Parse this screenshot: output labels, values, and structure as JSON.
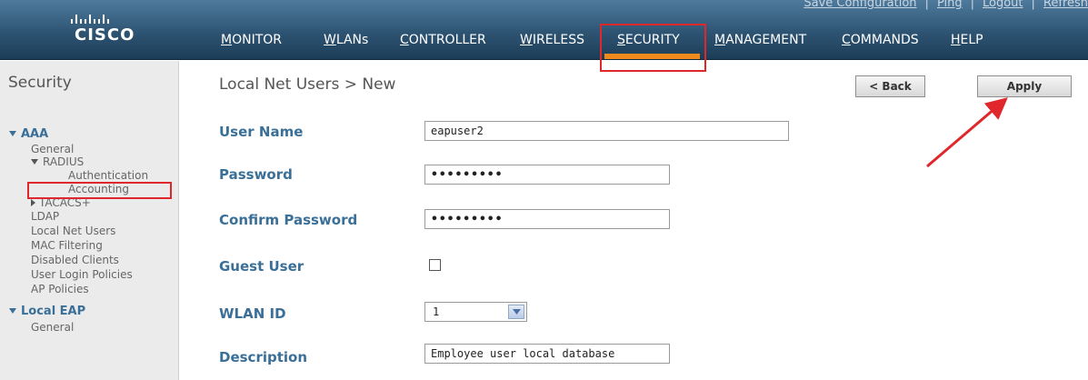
{
  "header": {
    "brand": "CISCO",
    "top_links": [
      "Save Configuration",
      "Ping",
      "Logout",
      "Refresh"
    ],
    "nav": [
      "MONITOR",
      "WLANs",
      "CONTROLLER",
      "WIRELESS",
      "SECURITY",
      "MANAGEMENT",
      "COMMANDS",
      "HELP"
    ],
    "active_nav": "SECURITY",
    "active_color": "#f08a1c"
  },
  "sidebar": {
    "title": "Security",
    "aaa": {
      "label": "AAA",
      "general": "General",
      "radius": "RADIUS",
      "authentication": "Authentication",
      "accounting": "Accounting",
      "tacacs": "TACACS+",
      "ldap": "LDAP",
      "local_net_users": "Local Net Users",
      "mac_filtering": "MAC Filtering",
      "disabled_clients": "Disabled Clients",
      "user_login_policies": "User Login Policies",
      "ap_policies": "AP Policies"
    },
    "local_eap": {
      "label": "Local EAP",
      "general": "General"
    }
  },
  "content": {
    "title": "Local Net Users > New",
    "back_label": "< Back",
    "apply_label": "Apply",
    "fields": {
      "user_name": {
        "label": "User Name",
        "value": "eapuser2"
      },
      "password": {
        "label": "Password",
        "value": "•••••••••"
      },
      "confirm_password": {
        "label": "Confirm Password",
        "value": "•••••••••"
      },
      "guest_user": {
        "label": "Guest User",
        "checked": false
      },
      "wlan_id": {
        "label": "WLAN ID",
        "value": "1"
      },
      "description": {
        "label": "Description",
        "value": "Employee user local database"
      }
    }
  },
  "colors": {
    "header": "#2e5473",
    "label_blue": "#3a6f97",
    "highlight_red": "#e0272b"
  }
}
